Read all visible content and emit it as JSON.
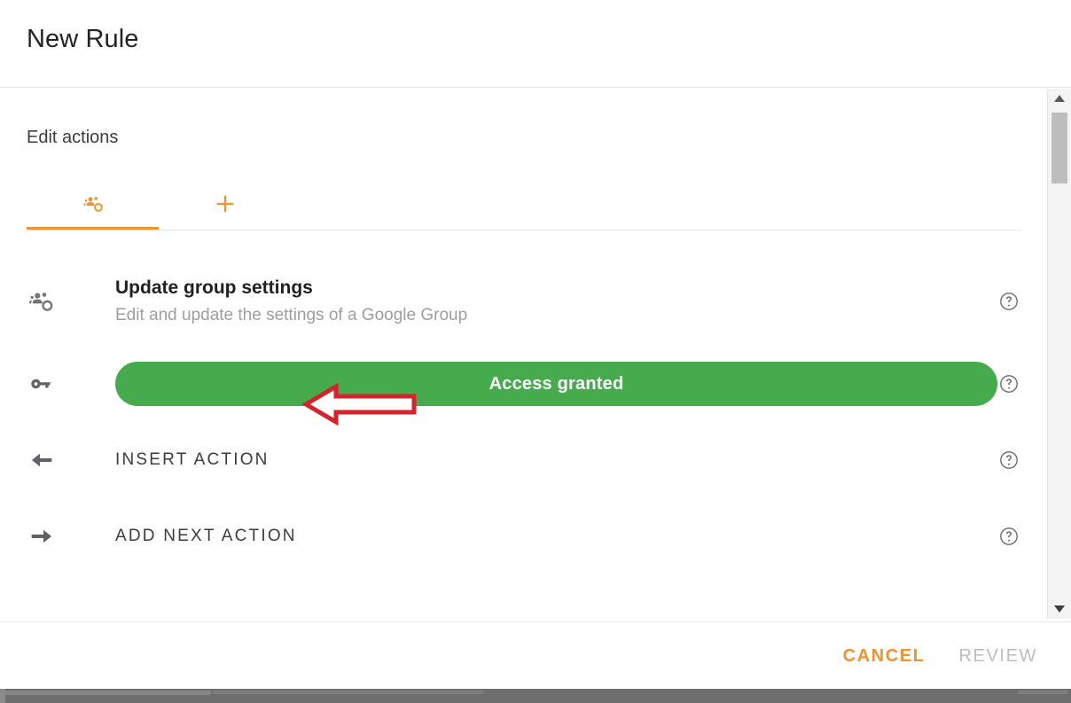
{
  "header": {
    "title": "New Rule"
  },
  "body": {
    "section_title": "Edit actions",
    "tabs": [
      {
        "icon": "group-settings-icon",
        "label": "",
        "active": true
      },
      {
        "icon": "plus-icon",
        "label": "",
        "active": false
      }
    ],
    "rows": [
      {
        "icon": "group-settings-icon",
        "title": "Update group settings",
        "subtitle": "Edit and update the settings of a Google Group",
        "help_icon": "help-circle-icon",
        "type": "title-sub"
      },
      {
        "icon": "key-icon",
        "chip_label": "Access granted",
        "chip_color": "#46ab4d",
        "help_icon": "help-circle-icon",
        "type": "chip"
      },
      {
        "icon": "arrow-left-icon",
        "title": "INSERT ACTION",
        "help_icon": "help-circle-icon",
        "type": "caps"
      },
      {
        "icon": "arrow-right-icon",
        "title": "ADD NEXT ACTION",
        "help_icon": "help-circle-icon",
        "type": "caps"
      }
    ]
  },
  "annotation": {
    "shape": "red-left-arrow",
    "color": "#d6222a"
  },
  "scrollbar": {
    "up_icon": "scroll-up-arrow-icon",
    "down_icon": "scroll-down-arrow-icon",
    "thumb_position": "near-top"
  },
  "footer": {
    "cancel_label": "CANCEL",
    "review_label": "REVIEW",
    "cancel_color": "#ef9331",
    "review_color": "#bdbdbd",
    "review_disabled": true
  }
}
